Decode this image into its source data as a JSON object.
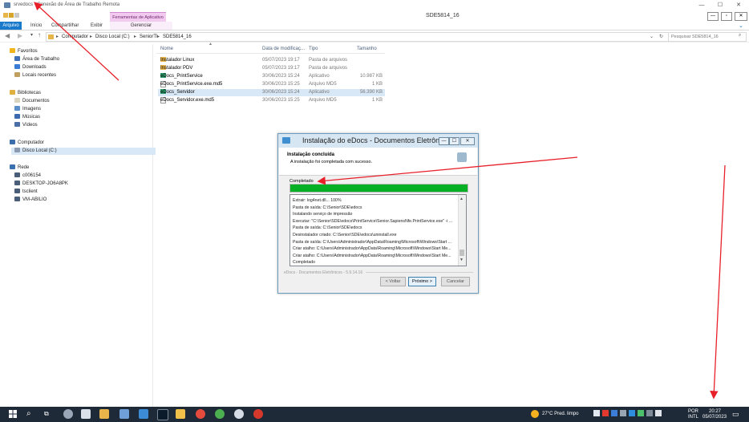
{
  "rdp": {
    "title": "srvedocs - Conexão de Área de Trabalho Remota",
    "minimize": "—",
    "maximize": "☐",
    "close": "✕"
  },
  "explorer": {
    "window_title": "SDE5814_16",
    "context_group": "Ferramentas de Aplicativo",
    "tabs": {
      "arquivo": "Arquivo",
      "inicio": "Início",
      "compartilhar": "Compartilhar",
      "exibir": "Exibir",
      "gerenciar": "Gerenciar"
    },
    "breadcrumb": [
      "Computador",
      "Disco Local (C:)",
      "SeniorTI",
      "SDE5814_16"
    ],
    "search_placeholder": "Pesquisar SDE5814_16"
  },
  "nav": {
    "favoritos": "Favoritos",
    "area_trabalho": "Área de Trabalho",
    "downloads": "Downloads",
    "locais_recentes": "Locais recentes",
    "bibliotecas": "Bibliotecas",
    "documentos": "Documentos",
    "imagens": "Imagens",
    "musicas": "Músicas",
    "videos": "Vídeos",
    "computador": "Computador",
    "disco_local": "Disco Local (C:)",
    "rede": "Rede",
    "rede_items": [
      "c006154",
      "DESKTOP-JO6A8PK",
      "tsclient",
      "VM-ABILIO"
    ]
  },
  "columns": {
    "name": "Nome",
    "date": "Data de modificaç...",
    "type": "Tipo",
    "size": "Tamanho"
  },
  "files": [
    {
      "name": "Instalador Linux",
      "date": "05/07/2023 19:17",
      "type": "Pasta de arquivos",
      "size": ""
    },
    {
      "name": "Instalador PDV",
      "date": "05/07/2023 19:17",
      "type": "Pasta de arquivos",
      "size": ""
    },
    {
      "name": "eDocs_PrintService",
      "date": "30/06/2023 15:24",
      "type": "Aplicativo",
      "size": "10.987 KB"
    },
    {
      "name": "eDocs_PrintService.exe.md5",
      "date": "30/06/2023 15:25",
      "type": "Arquivo MD5",
      "size": "1 KB"
    },
    {
      "name": "eDocs_Servidor",
      "date": "30/06/2023 15:24",
      "type": "Aplicativo",
      "size": "56.390 KB"
    },
    {
      "name": "eDocs_Servidor.exe.md5",
      "date": "30/06/2023 15:25",
      "type": "Arquivo MD5",
      "size": "1 KB"
    }
  ],
  "installer": {
    "title": "Instalação do eDocs - Documentos Eletrônicos",
    "heading": "Instalação concluída",
    "subheading": "A instalação foi completada com sucesso.",
    "progress_label": "Completado",
    "progress": 1.0,
    "log": [
      "Extrair: log4net.dll... 100%",
      "Pasta de saída: C:\\Senior\\SDE\\edocs",
      "Instalando serviço de impressão",
      "Executar: \"C:\\Senior\\SDE\\edocs\\PrintService\\Senior.SapiensNfe.PrintService.exe\" -i ...",
      "Pasta de saída: C:\\Senior\\SDE\\edocs",
      "Desinstalador criado: C:\\Senior\\SDE\\edocs\\uninstall.exe",
      "Pasta de saída: C:\\Users\\Administrador\\AppData\\Roaming\\Microsoft\\Windows\\Start ...",
      "Criar atalho: C:\\Users\\Administrador\\AppData\\Roaming\\Microsoft\\Windows\\Start Me...",
      "Criar atalho: C:\\Users\\Administrador\\AppData\\Roaming\\Microsoft\\Windows\\Start Me...",
      "Completado"
    ],
    "footer": "eDocs - Documentos Eletrônicos - 5.9.14.16",
    "btn_back": "< Voltar",
    "btn_next": "Próximo >",
    "btn_cancel": "Cancelar"
  },
  "taskbar": {
    "weather": "27°C  Pred. limpo",
    "lang1": "POR",
    "lang2": "INTL",
    "time": "20:27",
    "date": "05/07/2023"
  },
  "colors": {
    "progress": "#06b025",
    "annotation": "#e8202a",
    "taskbar": "#1f2a38",
    "accent": "#1979ca"
  }
}
